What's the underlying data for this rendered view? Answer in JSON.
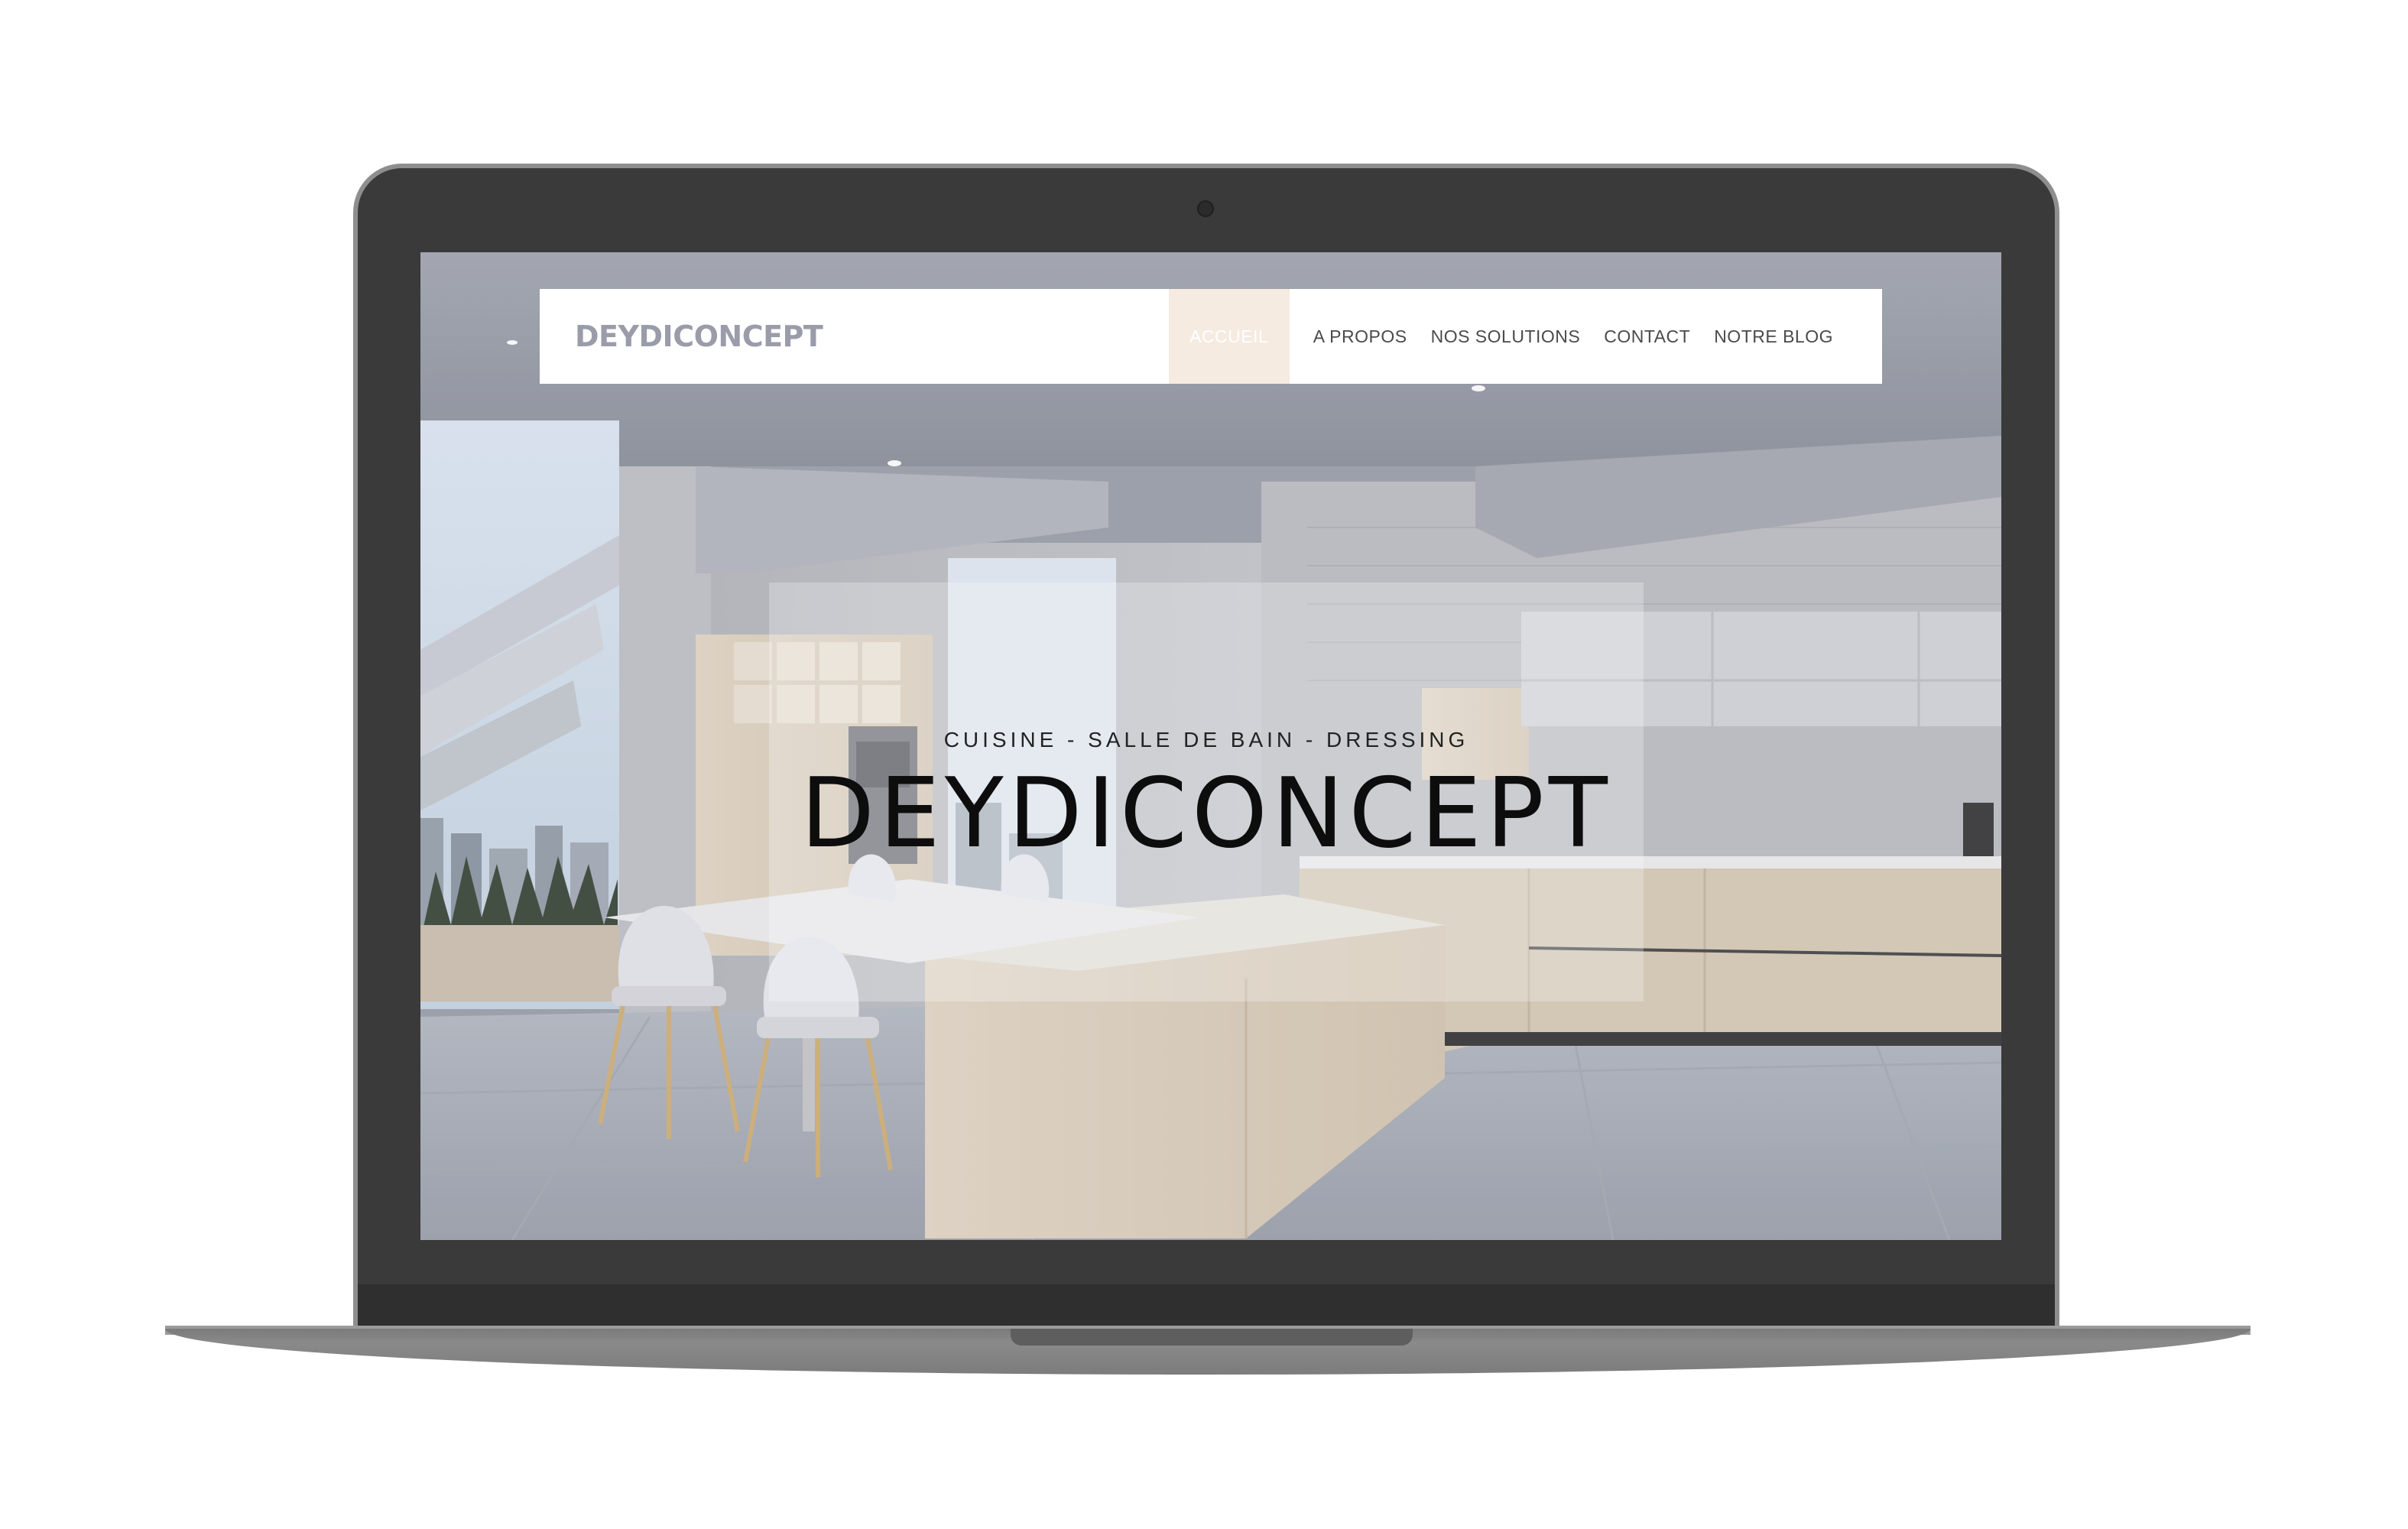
{
  "site": {
    "logo": "DEYDICONCEPT",
    "nav": [
      {
        "label": "ACCUEIL",
        "active": true
      },
      {
        "label": "A PROPOS",
        "active": false
      },
      {
        "label": "NOS SOLUTIONS",
        "active": false
      },
      {
        "label": "CONTACT",
        "active": false
      },
      {
        "label": "NOTRE BLOG",
        "active": false
      }
    ],
    "hero": {
      "subtitle": "CUISINE - SALLE DE BAIN - DRESSING",
      "title": "DEYDICONCEPT"
    }
  },
  "colors": {
    "laptop_frame": "#3a3a3a",
    "nav_active_bg": "#f5ebe0",
    "logo_gray": "#9a9caa"
  }
}
